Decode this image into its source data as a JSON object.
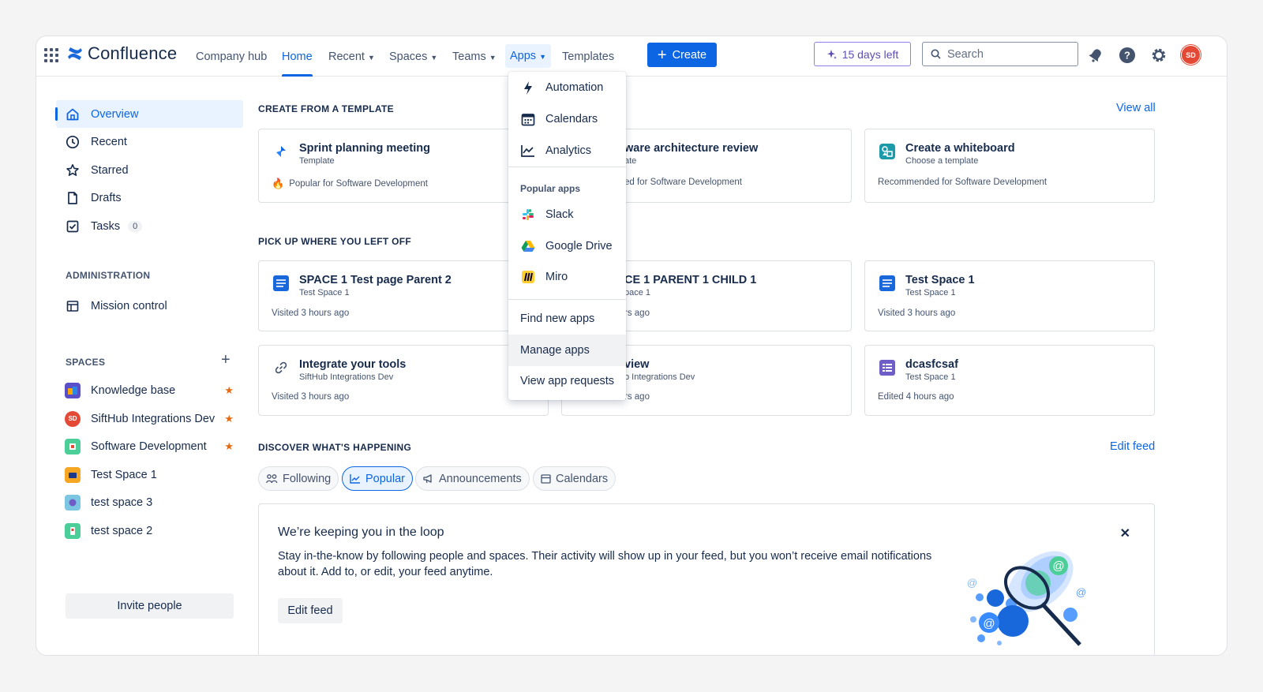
{
  "app": {
    "name": "Confluence"
  },
  "nav": {
    "company_hub": "Company hub",
    "home": "Home",
    "recent": "Recent",
    "spaces": "Spaces",
    "teams": "Teams",
    "apps": "Apps",
    "templates": "Templates",
    "create": "Create",
    "trial": "15 days left",
    "search_placeholder": "Search",
    "avatar_initials": "SD"
  },
  "sidebar": {
    "items": [
      {
        "label": "Overview",
        "icon": "home-icon"
      },
      {
        "label": "Recent",
        "icon": "clock-icon"
      },
      {
        "label": "Starred",
        "icon": "star-icon"
      },
      {
        "label": "Drafts",
        "icon": "page-icon"
      },
      {
        "label": "Tasks",
        "icon": "checkbox-icon",
        "count": "0"
      }
    ],
    "administration_heading": "ADMINISTRATION",
    "mission_control": "Mission control",
    "spaces_heading": "SPACES",
    "spaces": [
      {
        "label": "Knowledge base",
        "starred": true
      },
      {
        "label": "SiftHub Integrations Dev",
        "starred": true,
        "initials": "SD"
      },
      {
        "label": "Software Development",
        "starred": true
      },
      {
        "label": "Test Space 1",
        "starred": false
      },
      {
        "label": "test space 3",
        "starred": false
      },
      {
        "label": "test space 2",
        "starred": false
      }
    ],
    "invite": "Invite people"
  },
  "templates_section": {
    "title": "CREATE FROM A TEMPLATE",
    "view_all": "View all",
    "cards": [
      {
        "title": "Sprint planning meeting",
        "sub": "Template",
        "foot": "Popular for Software Development"
      },
      {
        "title": "ware architecture review",
        "sub": "ate",
        "foot": "ed for Software Development"
      },
      {
        "title": "Create a whiteboard",
        "sub": "Choose a template",
        "foot": "Recommended for Software Development"
      }
    ]
  },
  "recent_section": {
    "title": "PICK UP WHERE YOU LEFT OFF",
    "cards": [
      {
        "title": "SPACE 1 Test page Parent 2",
        "sub": "Test Space 1",
        "foot": "Visited 3 hours ago"
      },
      {
        "title": "CE 1 PARENT 1 CHILD 1",
        "sub": "pace 1",
        "foot": "rs ago"
      },
      {
        "title": "Test Space 1",
        "sub": "Test Space 1",
        "foot": "Visited 3 hours ago"
      },
      {
        "title": "Integrate your tools",
        "sub": "SiftHub Integrations Dev",
        "foot": "Visited 3 hours ago"
      },
      {
        "title": "view",
        "sub": "b Integrations Dev",
        "foot": "rs ago"
      },
      {
        "title": "dcasfcsaf",
        "sub": "Test Space 1",
        "foot": "Edited 4 hours ago"
      }
    ]
  },
  "discover_section": {
    "title": "DISCOVER WHAT'S HAPPENING",
    "edit_feed": "Edit feed",
    "pills": [
      "Following",
      "Popular",
      "Announcements",
      "Calendars"
    ],
    "active_pill": "Popular"
  },
  "loop_card": {
    "title": "We’re keeping you in the loop",
    "text": "Stay in-the-know by following people and spaces. Their activity will show up in your feed, but you won’t receive email notifications about it. Add to, or edit, your feed anytime.",
    "button": "Edit feed"
  },
  "apps_menu": {
    "items": [
      {
        "label": "Automation",
        "icon": "lightning-icon"
      },
      {
        "label": "Calendars",
        "icon": "calendar-icon"
      },
      {
        "label": "Analytics",
        "icon": "analytics-icon"
      }
    ],
    "popular_heading": "Popular apps",
    "popular": [
      {
        "label": "Slack",
        "icon": "slack-icon"
      },
      {
        "label": "Google Drive",
        "icon": "google-drive-icon"
      },
      {
        "label": "Miro",
        "icon": "miro-icon"
      }
    ],
    "find": "Find new apps",
    "manage": "Manage apps",
    "requests": "View app requests"
  },
  "colors": {
    "accent": "#0c66e4",
    "star": "#e56910",
    "trial": "#5e4db2"
  }
}
